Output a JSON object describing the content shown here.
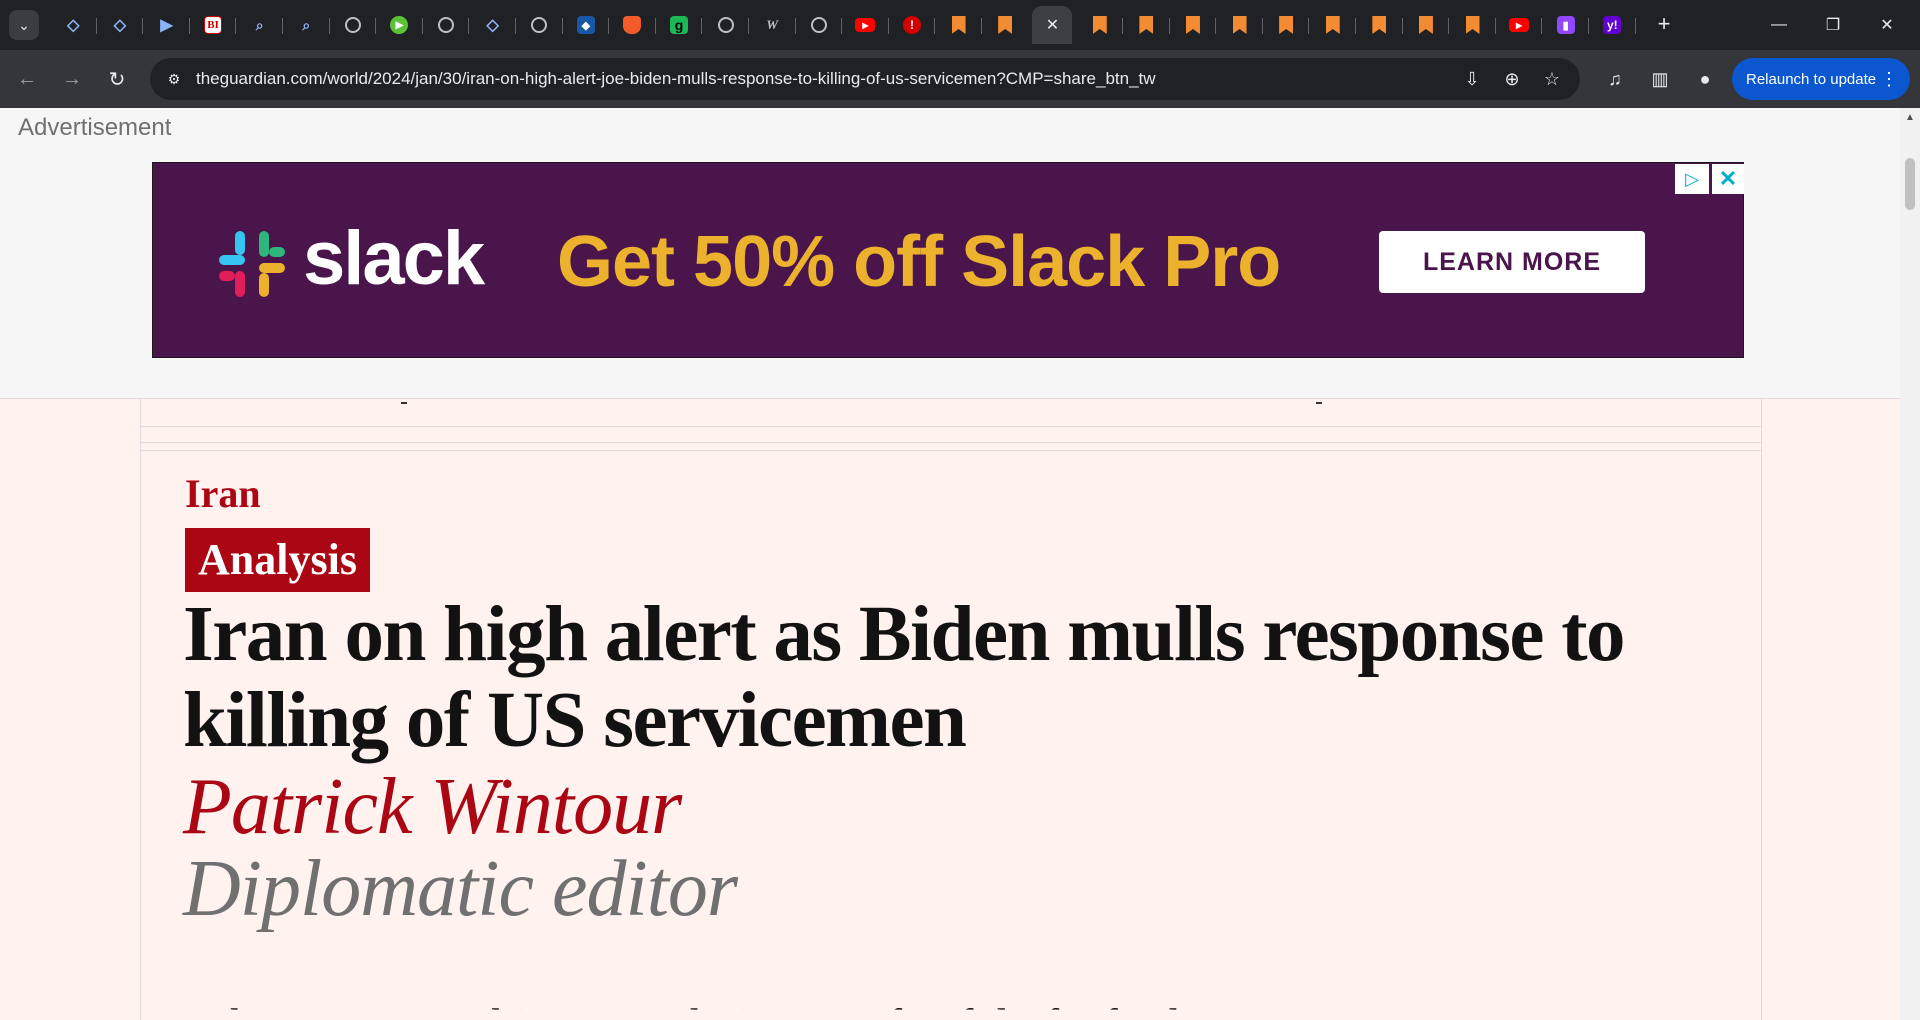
{
  "browser": {
    "tabs": [
      {
        "icon": "shield-icon",
        "kind": "shield",
        "glyph": "◇"
      },
      {
        "icon": "shield-icon",
        "kind": "shield",
        "glyph": "◇"
      },
      {
        "icon": "arrow-tag-icon",
        "kind": "shield",
        "glyph": "▶"
      },
      {
        "icon": "business-insider-icon",
        "kind": "biz",
        "glyph": "BI"
      },
      {
        "icon": "find-icon",
        "kind": "find",
        "glyph": "⌕"
      },
      {
        "icon": "find-icon",
        "kind": "find",
        "glyph": "⌕"
      },
      {
        "icon": "globe-icon",
        "kind": "globe",
        "glyph": ""
      },
      {
        "icon": "play-icon",
        "kind": "play",
        "glyph": "▶"
      },
      {
        "icon": "globe-icon",
        "kind": "globe",
        "glyph": ""
      },
      {
        "icon": "shield-icon",
        "kind": "shield",
        "glyph": "◇"
      },
      {
        "icon": "globe-icon",
        "kind": "globe",
        "glyph": ""
      },
      {
        "icon": "cube-icon",
        "kind": "cube",
        "glyph": "◆"
      },
      {
        "icon": "brave-icon",
        "kind": "brave",
        "glyph": ""
      },
      {
        "icon": "g-icon",
        "kind": "g",
        "glyph": "g"
      },
      {
        "icon": "globe-icon",
        "kind": "globe",
        "glyph": ""
      },
      {
        "icon": "wired-icon",
        "kind": "wire",
        "glyph": "W"
      },
      {
        "icon": "globe-icon",
        "kind": "globe",
        "glyph": ""
      },
      {
        "icon": "youtube-icon",
        "kind": "yt",
        "glyph": "▶"
      },
      {
        "icon": "red-news-icon",
        "kind": "red",
        "glyph": "!"
      },
      {
        "icon": "bookmark-icon",
        "kind": "bm",
        "glyph": ""
      },
      {
        "icon": "bookmark-icon",
        "kind": "bm",
        "glyph": ""
      },
      {
        "icon": "close-icon",
        "kind": "active",
        "glyph": "✕"
      },
      {
        "icon": "bookmark-icon",
        "kind": "bm",
        "glyph": ""
      },
      {
        "icon": "bookmark-icon",
        "kind": "bm",
        "glyph": ""
      },
      {
        "icon": "bookmark-icon",
        "kind": "bm",
        "glyph": ""
      },
      {
        "icon": "bookmark-icon",
        "kind": "bm",
        "glyph": ""
      },
      {
        "icon": "bookmark-icon",
        "kind": "bm",
        "glyph": ""
      },
      {
        "icon": "bookmark-icon",
        "kind": "bm",
        "glyph": ""
      },
      {
        "icon": "bookmark-icon",
        "kind": "bm",
        "glyph": ""
      },
      {
        "icon": "bookmark-icon",
        "kind": "bm",
        "glyph": ""
      },
      {
        "icon": "bookmark-icon",
        "kind": "bm",
        "glyph": ""
      },
      {
        "icon": "youtube-icon",
        "kind": "yt",
        "glyph": "▶"
      },
      {
        "icon": "twitch-icon",
        "kind": "twitch",
        "glyph": "▮"
      },
      {
        "icon": "yahoo-icon",
        "kind": "yahoo",
        "glyph": "y!"
      }
    ],
    "url": "theguardian.com/world/2024/jan/30/iran-on-high-alert-joe-biden-mulls-response-to-killing-of-us-servicemen?CMP=share_btn_tw",
    "relaunch_label": "Relaunch to update"
  },
  "ad": {
    "label": "Advertisement",
    "brand": "slack",
    "headline": "Get 50% off Slack Pro",
    "cta": "LEARN MORE",
    "colors": {
      "background": "#4a154b",
      "headline": "#ecb22e",
      "cta_text": "#4a154b",
      "adchoices": "#00aecd"
    }
  },
  "article": {
    "kicker": "Iran",
    "badge": "Analysis",
    "headline": "Iran on high alert as Biden mulls response to killing of US servicemen",
    "author": "Patrick Wintour",
    "role": "Diplomatic editor",
    "standfirst_partial": "Tehran says Washington's choices are fearful of a further",
    "colors": {
      "accent": "#ab0613",
      "text": "#121212",
      "muted": "#707070",
      "page_bg": "#fff2ef"
    }
  }
}
